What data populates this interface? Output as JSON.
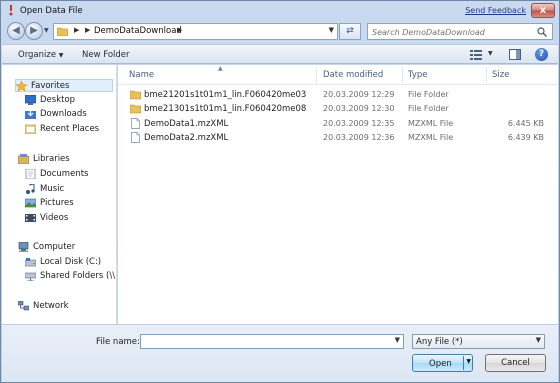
{
  "window": {
    "title": "Open Data File",
    "feedback_link": "Send Feedback",
    "close_glyph": "x"
  },
  "address": {
    "crumb": "DemoDataDownload",
    "search_placeholder": "Search DemoDataDownload"
  },
  "toolbar": {
    "organize": "Organize",
    "new_folder": "New Folder"
  },
  "nav": {
    "favorites": "Favorites",
    "desktop": "Desktop",
    "downloads": "Downloads",
    "recent_places": "Recent Places",
    "libraries": "Libraries",
    "documents": "Documents",
    "music": "Music",
    "pictures": "Pictures",
    "videos": "Videos",
    "computer": "Computer",
    "local_disk": "Local Disk (C:)",
    "shared_folders": "Shared Folders (\\\\.host",
    "network": "Network"
  },
  "columns": {
    "name": "Name",
    "date": "Date modified",
    "type": "Type",
    "size": "Size"
  },
  "files": [
    {
      "name": "bme21201s1t01m1_lin.F060420me03",
      "date": "20.03.2009 12:29",
      "type": "File Folder",
      "size": "",
      "kind": "folder"
    },
    {
      "name": "bme21301s1t01m1_lin.F060420me08",
      "date": "20.03.2009 12:30",
      "type": "File Folder",
      "size": "",
      "kind": "folder"
    },
    {
      "name": "DemoData1.mzXML",
      "date": "20.03.2009 12:35",
      "type": "MZXML File",
      "size": "6.445 KB",
      "kind": "file"
    },
    {
      "name": "DemoData2.mzXML",
      "date": "20.03.2009 12:36",
      "type": "MZXML File",
      "size": "6.439 KB",
      "kind": "file"
    }
  ],
  "bottom": {
    "file_name_label": "File name:",
    "file_name_value": "",
    "filter": "Any File (*)",
    "open": "Open",
    "cancel": "Cancel"
  },
  "colors": {
    "accent": "#1d4fae",
    "folder": "#e8c15a"
  }
}
